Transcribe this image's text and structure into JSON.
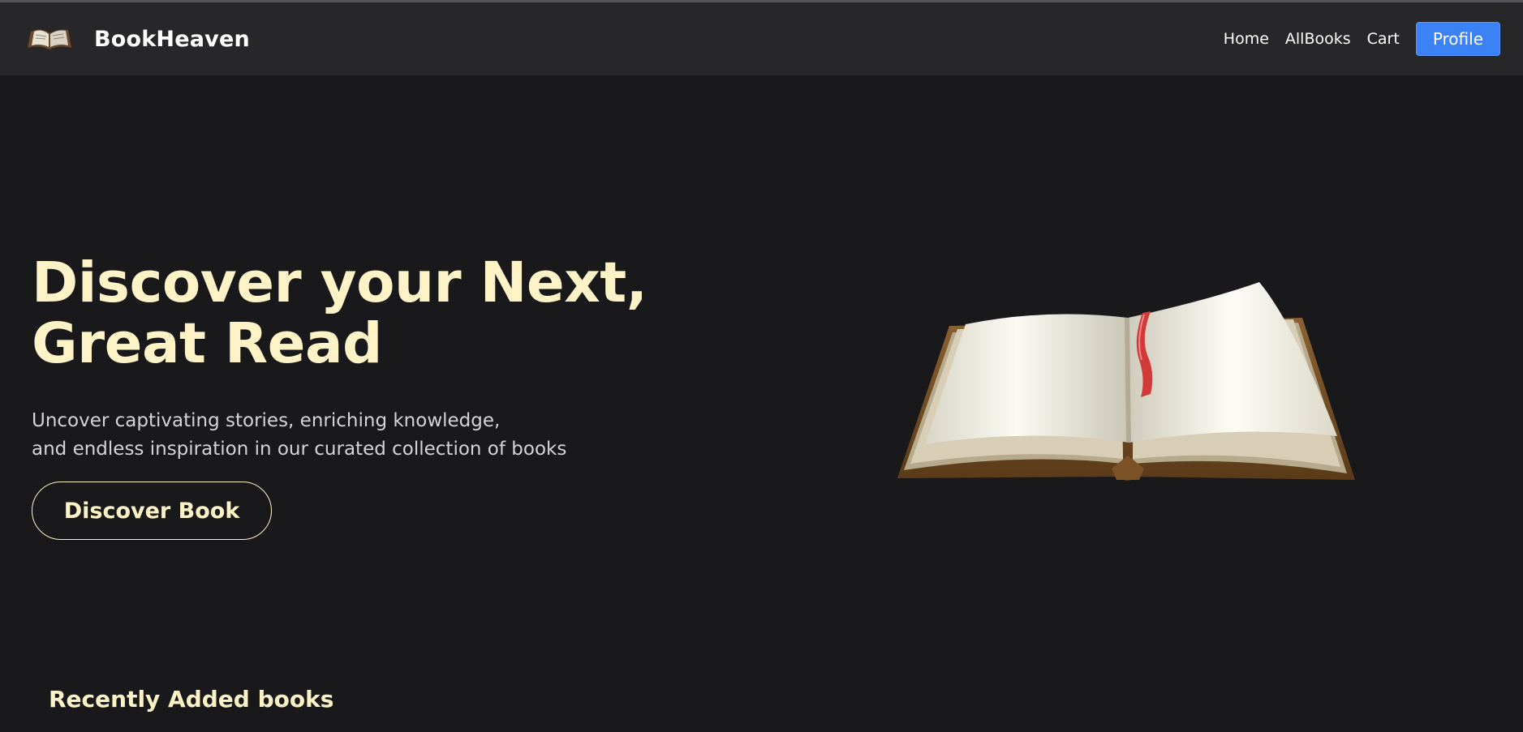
{
  "nav": {
    "brand": "BookHeaven",
    "logo_icon": "open-book-icon",
    "links": [
      "Home",
      "AllBooks",
      "Cart"
    ],
    "profile_label": "Profile",
    "accent_color": "#3b82f6"
  },
  "hero": {
    "title_lines": [
      "Discover your Next,",
      "Great Read"
    ],
    "subtitle_lines": [
      "Uncover captivating stories, enriching knowledge,",
      "and endless inspiration in our curated collection of books"
    ],
    "cta_label": "Discover Book",
    "illustration": "open-book-with-red-ribbon",
    "title_color": "#fef3c7"
  },
  "recent": {
    "heading": "Recently Added books"
  }
}
